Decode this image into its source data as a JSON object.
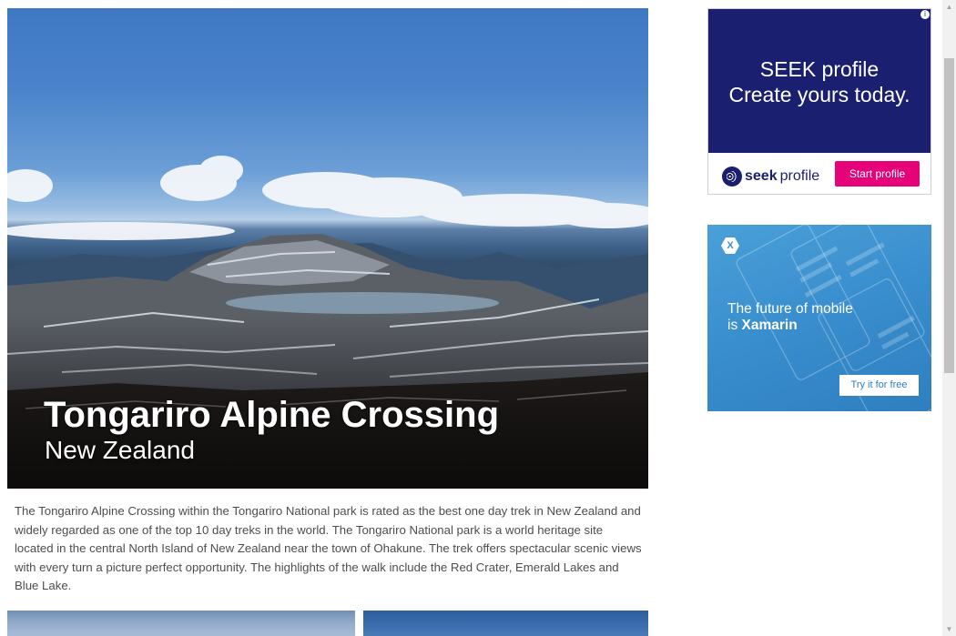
{
  "hero": {
    "title": "Tongariro Alpine Crossing",
    "subtitle": "New Zealand"
  },
  "article": {
    "text": "The Tongariro Alpine Crossing within the Tongariro National park is rated as the best one day trek in New Zealand and widely regarded as one of the top 10 day treks in the world. The Tongariro National park is a world heritage site located in the central North Island of New Zealand near the town of Ohakune. The trek offers spectacular scenic views with every turn a picture perfect opportunity. The highlights of the walk include the Red Crater, Emerald Lakes and Blue Lake."
  },
  "ads": {
    "seek": {
      "headline_line1": "SEEK profile",
      "headline_line2": "Create yours today.",
      "logo_word": "seek",
      "logo_suffix": "profile",
      "cta": "Start profile",
      "adchoices_icon": "info-icon",
      "colors": {
        "background": "#1a1f6f",
        "cta": "#e60278"
      }
    },
    "xamarin": {
      "logo_letter": "X",
      "headline_line1": "The future of mobile",
      "headline_prefix": "is ",
      "headline_brand": "Xamarin",
      "cta": "Try it for free",
      "colors": {
        "background": "#3a8fce"
      }
    }
  },
  "scrollbar": {
    "up_icon": "chevron-up-icon",
    "down_icon": "chevron-down-icon"
  }
}
